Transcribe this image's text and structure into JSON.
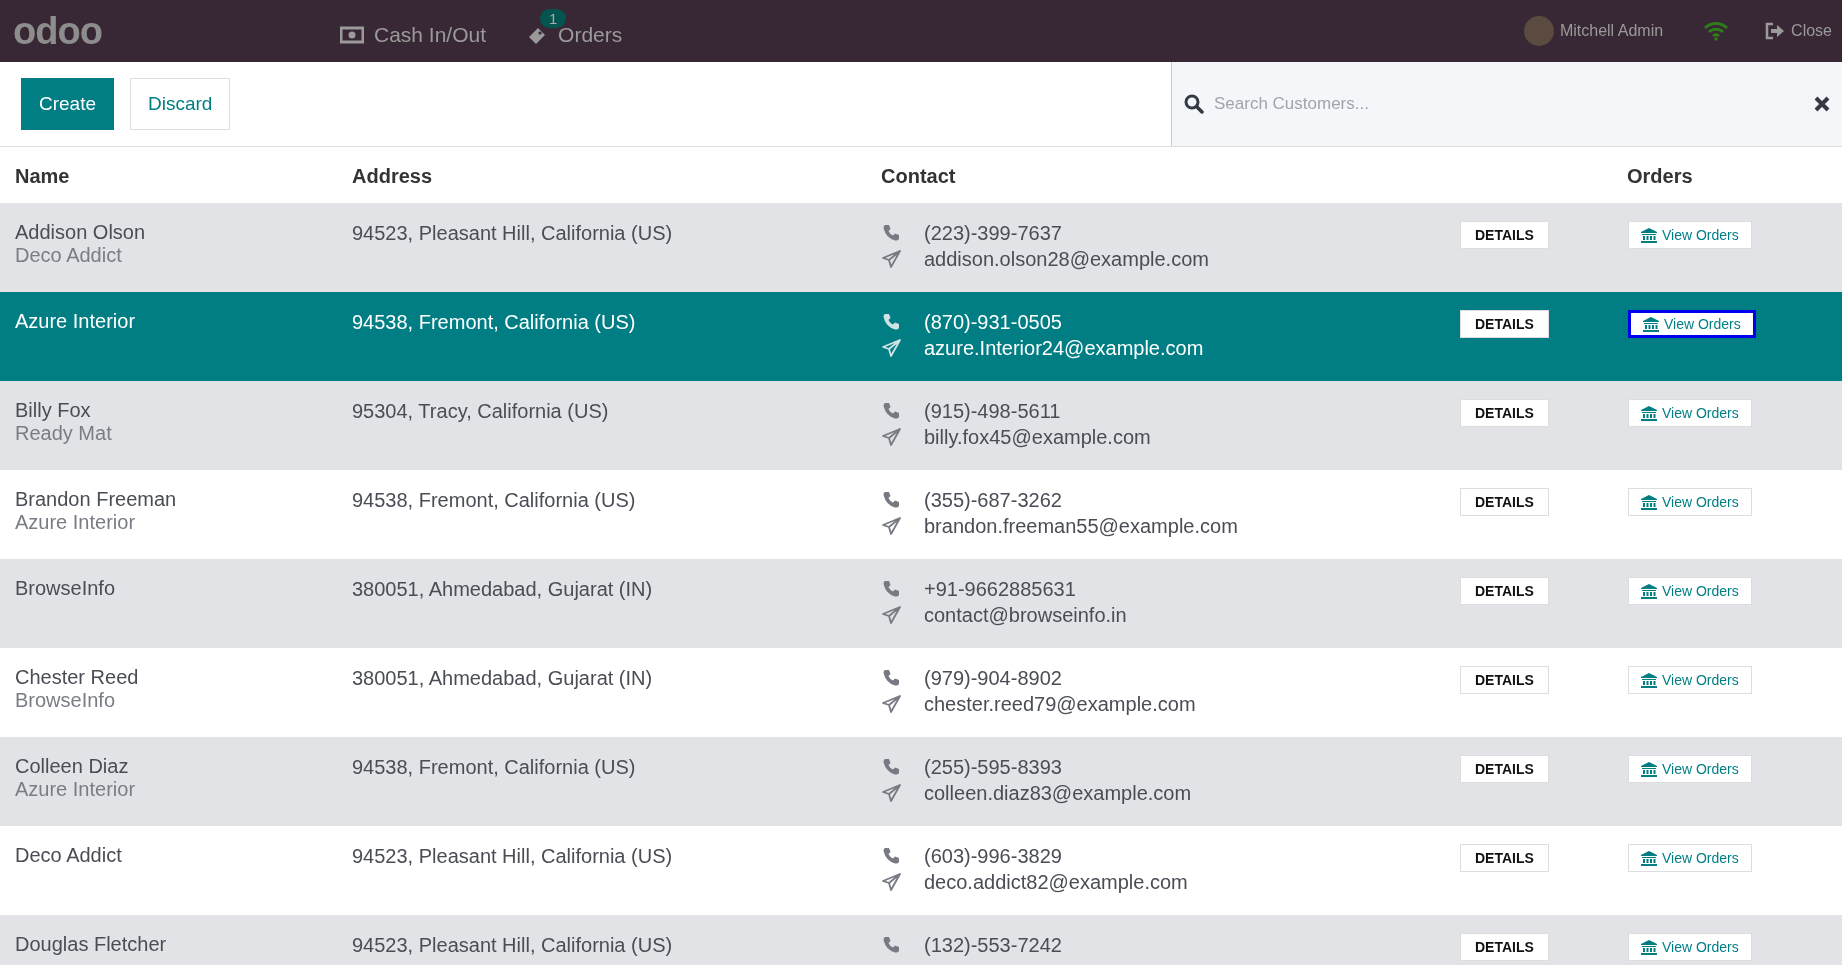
{
  "navbar": {
    "logo": "odoo",
    "items": [
      {
        "kind": "cash",
        "label": "Cash In/Out"
      },
      {
        "kind": "orders",
        "label": "Orders",
        "badge": "1"
      }
    ],
    "user": "Mitchell Admin",
    "close": "Close"
  },
  "toolbar": {
    "buttons": [
      {
        "label": "Create",
        "primary": true
      },
      {
        "label": "Discard",
        "primary": false
      }
    ],
    "search": {
      "placeholder": "Search Customers..."
    }
  },
  "table": {
    "columns": [
      "Name",
      "Address",
      "Contact",
      "",
      "Orders"
    ],
    "rows": [
      {
        "name": "Addison Olson",
        "company": "Deco Addict",
        "address": "94523, Pleasant Hill, California (US)",
        "phone": "(223)-399-7637",
        "email": "addison.olson28@example.com",
        "details": "DETAILS",
        "orders": "View Orders",
        "selected": false,
        "focused": false
      },
      {
        "name": "Azure Interior",
        "address": "94538, Fremont, California (US)",
        "phone": "(870)-931-0505",
        "email": "azure.Interior24@example.com",
        "details": "DETAILS",
        "orders": "View Orders",
        "selected": true,
        "focused": true
      },
      {
        "name": "Billy Fox",
        "company": "Ready Mat",
        "address": "95304, Tracy, California (US)",
        "phone": "(915)-498-5611",
        "email": "billy.fox45@example.com",
        "details": "DETAILS",
        "orders": "View Orders",
        "selected": false,
        "focused": false
      },
      {
        "name": "Brandon Freeman",
        "company": "Azure Interior",
        "address": "94538, Fremont, California (US)",
        "phone": "(355)-687-3262",
        "email": "brandon.freeman55@example.com",
        "details": "DETAILS",
        "orders": "View Orders",
        "selected": false,
        "focused": false
      },
      {
        "name": "BrowseInfo",
        "address": "380051, Ahmedabad, Gujarat (IN)",
        "phone": "+91-9662885631",
        "email": "contact@browseinfo.in",
        "details": "DETAILS",
        "orders": "View Orders",
        "selected": false,
        "focused": false
      },
      {
        "name": "Chester Reed",
        "company": "BrowseInfo",
        "address": "380051, Ahmedabad, Gujarat (IN)",
        "phone": "(979)-904-8902",
        "email": "chester.reed79@example.com",
        "details": "DETAILS",
        "orders": "View Orders",
        "selected": false,
        "focused": false
      },
      {
        "name": "Colleen Diaz",
        "company": "Azure Interior",
        "address": "94538, Fremont, California (US)",
        "phone": "(255)-595-8393",
        "email": "colleen.diaz83@example.com",
        "details": "DETAILS",
        "orders": "View Orders",
        "selected": false,
        "focused": false
      },
      {
        "name": "Deco Addict",
        "address": "94523, Pleasant Hill, California (US)",
        "phone": "(603)-996-3829",
        "email": "deco.addict82@example.com",
        "details": "DETAILS",
        "orders": "View Orders",
        "selected": false,
        "focused": false
      },
      {
        "name": "Douglas Fletcher",
        "address": "94523, Pleasant Hill, California (US)",
        "phone": "(132)-553-7242",
        "details": "DETAILS",
        "orders": "View Orders",
        "selected": false,
        "focused": false
      }
    ]
  }
}
